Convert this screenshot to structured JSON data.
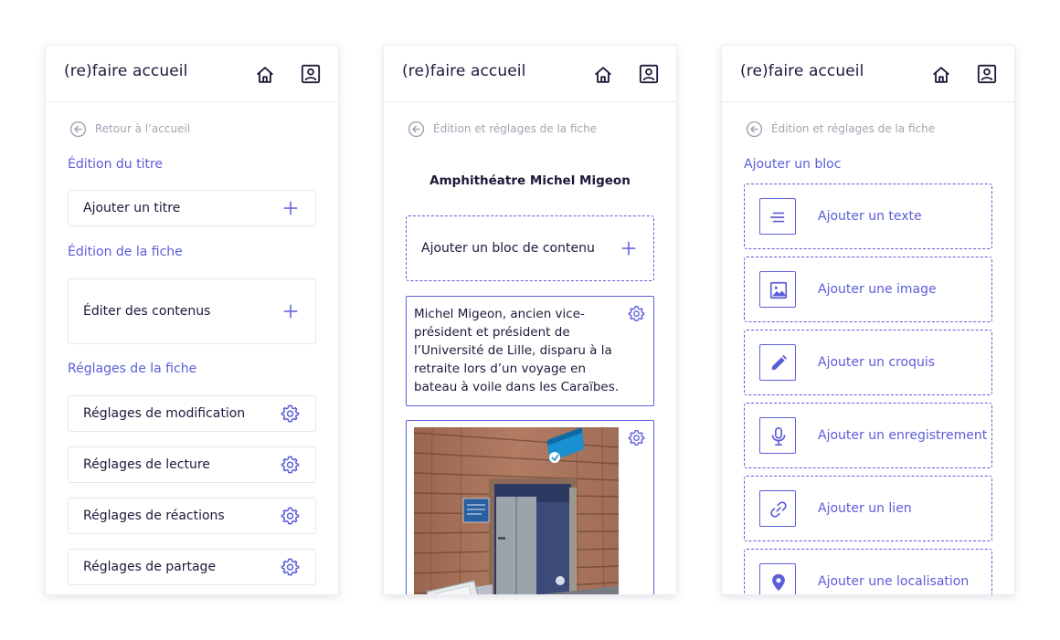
{
  "app": {
    "title": "(re)faire accueil"
  },
  "colors": {
    "accent": "#5b5dd8",
    "text": "#1b1a3a",
    "muted": "#a3a3b3",
    "border": "#e7e7ee"
  },
  "icons": {
    "home": "home-icon",
    "profile": "user-badge-icon",
    "back": "arrow-left-circle-icon",
    "add": "plus-icon",
    "settings": "gear-icon"
  },
  "screen1": {
    "back_label": "Retour à l’accueil",
    "section_title": "Édition du titre",
    "add_title": "Ajouter un titre",
    "section_content": "Édition de la fiche",
    "edit_content": "Éditer des contenus",
    "section_settings": "Réglages de la fiche",
    "settings": [
      {
        "label": "Réglages de modification"
      },
      {
        "label": "Réglages de lecture"
      },
      {
        "label": "Réglages de réactions"
      },
      {
        "label": "Réglages de partage"
      }
    ]
  },
  "screen2": {
    "back_label": "Édition et réglages de la fiche",
    "card_title": "Amphithéatre Michel Migeon",
    "add_block": "Ajouter un bloc de contenu",
    "text_content": "Michel Migeon, ancien vice-président et président de l’Université de Lille, disparu à la retraite lors d’un voyage en bateau à voile dans les Caraïbes.",
    "image_sign": "Amphithéâtre Michel MIGEON"
  },
  "screen3": {
    "back_label": "Édition et réglages de la fiche",
    "section_title": "Ajouter un bloc",
    "blocks": [
      {
        "label": "Ajouter un texte",
        "icon": "text-lines-icon"
      },
      {
        "label": "Ajouter une image",
        "icon": "image-icon"
      },
      {
        "label": "Ajouter un croquis",
        "icon": "pencil-icon"
      },
      {
        "label": "Ajouter un enregistrement",
        "icon": "microphone-icon"
      },
      {
        "label": "Ajouter un lien",
        "icon": "link-icon"
      },
      {
        "label": "Ajouter une localisation",
        "icon": "location-pin-icon"
      }
    ]
  }
}
